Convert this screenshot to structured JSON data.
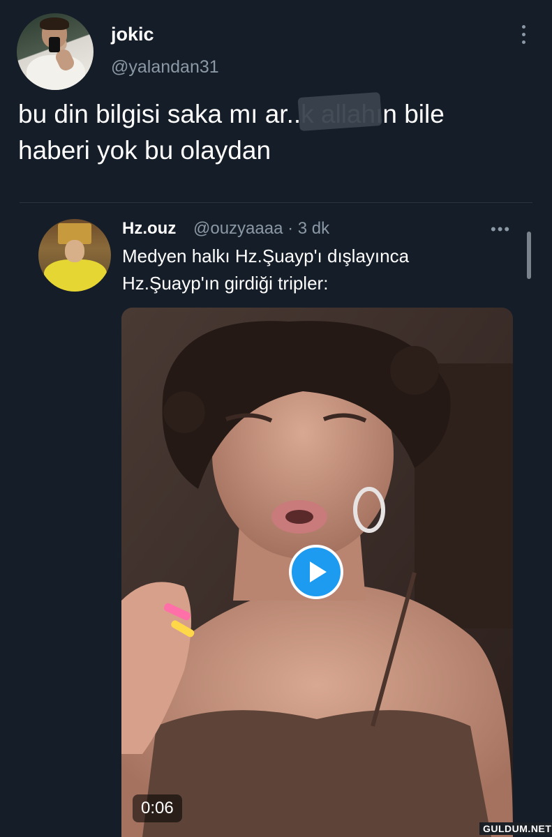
{
  "author": {
    "name": "jokic",
    "handle": "@yalandan31"
  },
  "tweet": {
    "text_line1": "bu din bilgisi saka mı ar..k allahın bile",
    "text_line2": "haberi yok bu olaydan"
  },
  "quoted": {
    "name": "Hz.ouz",
    "meta": "@ouzyaaaa · 3 dk",
    "text_line1": "Medyen halkı Hz.Şuayp'ı dışlayınca",
    "text_line2": "Hz.Şuayp'ın girdiği tripler:",
    "video_duration": "0:06"
  },
  "icons": {
    "more_vertical": "more-vertical-icon",
    "more_horizontal": "more-horizontal-icon",
    "play": "play-icon"
  },
  "colors": {
    "background": "#151d28",
    "accent": "#1d9bf0",
    "secondary_text": "#8b98a5"
  },
  "watermark": "GULDUM.NET"
}
